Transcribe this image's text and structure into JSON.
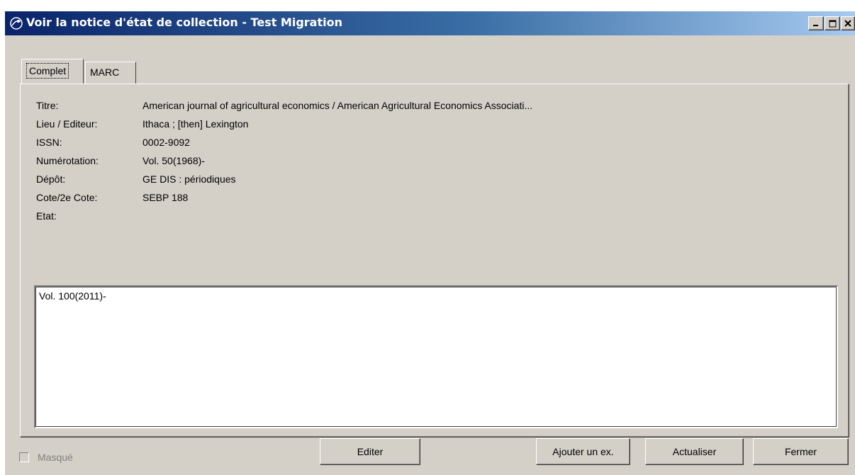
{
  "window": {
    "title": "Voir la notice d'état de collection - Test Migration",
    "icon": "satellite-dish-icon"
  },
  "tabs": [
    {
      "label": "Complet",
      "active": true
    },
    {
      "label": "MARC",
      "active": false
    }
  ],
  "fields": [
    {
      "label": "Titre:",
      "value": "American journal of agricultural economics / American Agricultural Economics Associati..."
    },
    {
      "label": "Lieu / Editeur:",
      "value": "Ithaca ; [then] Lexington"
    },
    {
      "label": "ISSN:",
      "value": "0002-9092"
    },
    {
      "label": "Numérotation:",
      "value": "Vol. 50(1968)-"
    },
    {
      "label": "Dépôt:",
      "value": "GE DIS : périodiques"
    },
    {
      "label": "Cote/2e Cote:",
      "value": "SEBP 188"
    },
    {
      "label": "Etat:",
      "value": ""
    }
  ],
  "etat_text": "Vol. 100(2011)-",
  "masque": {
    "label": "Masqué",
    "checked": false,
    "enabled": false
  },
  "buttons": {
    "editer": "Editer",
    "ajouter": "Ajouter un ex.",
    "actualiser": "Actualiser",
    "fermer": "Fermer"
  },
  "colors": {
    "titlebar_start": "#0a246a",
    "titlebar_end": "#a6caf0",
    "face": "#d4d0c8"
  }
}
